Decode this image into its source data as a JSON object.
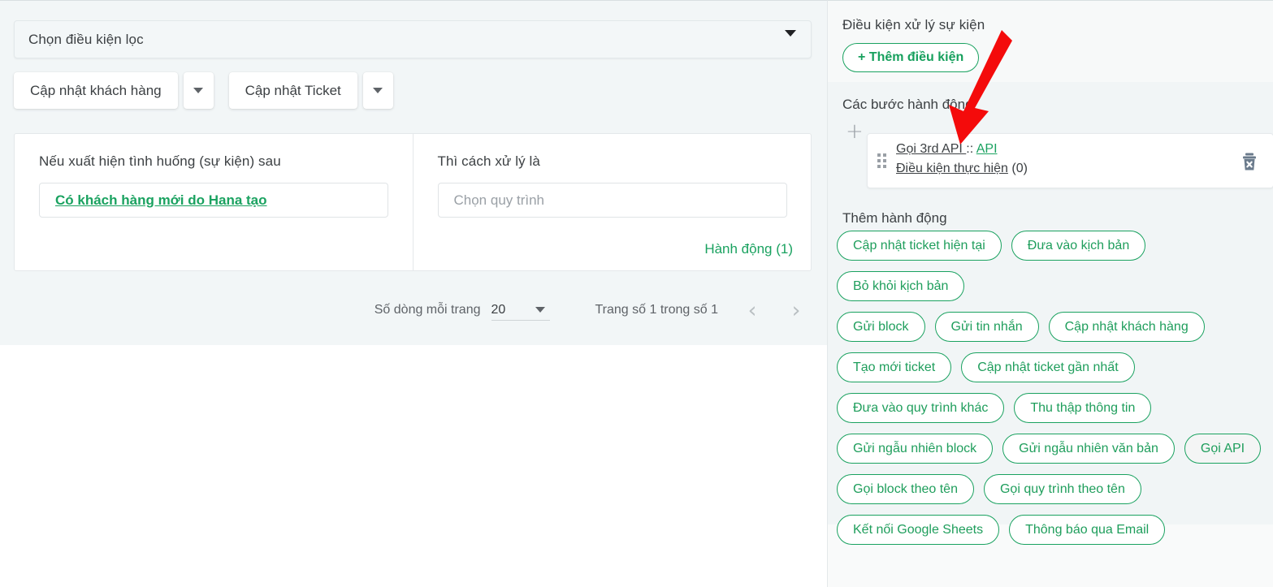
{
  "left_panel": {
    "filter": {
      "placeholder": "Chọn điều kiện lọc",
      "caret_icon": "chevron-down-icon"
    },
    "buttons": [
      {
        "label": "Cập nhật khách hàng",
        "caret_icon": "chevron-down-icon"
      },
      {
        "label": "Cập nhật Ticket",
        "caret_icon": "chevron-down-icon"
      }
    ],
    "rule_card": {
      "event_column": {
        "title": "Nếu xuất hiện tình huống (sự kiện) sau",
        "event_link": "Có khách hàng mới do Hana tạo"
      },
      "handler_column": {
        "title": "Thì cách xử lý là",
        "process_placeholder": "Chọn quy trình",
        "action_link": "Hành động (1)"
      }
    },
    "pagination": {
      "rows_label": "Số dòng mỗi trang",
      "rows_value": "20",
      "rows_caret_icon": "chevron-down-icon",
      "page_info": "Trang số 1 trong số 1",
      "prev_icon": "chevron-left-icon",
      "next_icon": "chevron-right-icon"
    }
  },
  "sidebar": {
    "condition_section": {
      "title": "Điều kiện xử lý sự kiện",
      "add_button": "+ Thêm điều kiện"
    },
    "steps_section": {
      "title": "Các bước hành động",
      "add_step_icon": "plus-icon",
      "step": {
        "drag_handle_icon": "drag-handle-icon",
        "name_prefix": "Gọi 3rd API ",
        "name_separator": ":: ",
        "name_suffix": "API",
        "condition_link": "Điều kiện thực hiện",
        "condition_count": "(0)",
        "delete_icon": "trash-icon"
      }
    },
    "add_action_section": {
      "title": "Thêm hành động",
      "chips": [
        {
          "label": "Cập nhật ticket hiện tại",
          "hovered": false
        },
        {
          "label": "Đưa vào kịch bản",
          "hovered": false
        },
        {
          "label": "Bỏ khỏi kịch bản",
          "hovered": false,
          "break_after": true
        },
        {
          "label": "Gửi block",
          "hovered": false
        },
        {
          "label": "Gửi tin nhắn",
          "hovered": false
        },
        {
          "label": "Cập nhật khách hàng",
          "hovered": false,
          "break_after": true
        },
        {
          "label": "Tạo mới ticket",
          "hovered": false
        },
        {
          "label": "Cập nhật ticket gần nhất",
          "hovered": false,
          "break_after": true
        },
        {
          "label": "Đưa vào quy trình khác",
          "hovered": false
        },
        {
          "label": "Thu thập thông tin",
          "hovered": false,
          "break_after": true
        },
        {
          "label": "Gửi ngẫu nhiên block",
          "hovered": false
        },
        {
          "label": "Gửi ngẫu nhiên văn bản",
          "hovered": false
        },
        {
          "label": "Gọi API",
          "hovered": true,
          "break_after": true
        },
        {
          "label": "Gọi block theo tên",
          "hovered": false
        },
        {
          "label": "Gọi quy trình theo tên",
          "hovered": false,
          "break_after": true
        },
        {
          "label": "Kết nối Google Sheets",
          "hovered": false
        },
        {
          "label": "Thông báo qua Email",
          "hovered": false
        }
      ]
    }
  },
  "annotation": {
    "arrow_icon": "red-arrow-icon",
    "color": "#f40b0b"
  },
  "colors": {
    "accent_green": "#1aa260",
    "text_primary": "#3c4043",
    "text_muted": "#5f6368",
    "panel_bg": "#f2f6f7",
    "sidebar_bg": "#f1f5f6",
    "annotation_red": "#f40b0b"
  }
}
